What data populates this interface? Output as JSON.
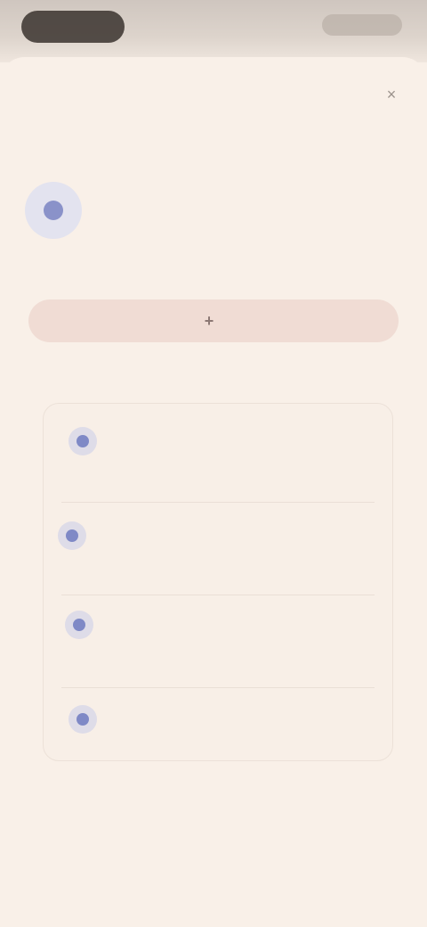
{
  "sheet": {
    "title": "",
    "close_glyph": "×"
  },
  "profile": {
    "name": "",
    "description": ""
  },
  "primary_action": {
    "icon": "+",
    "label": ""
  },
  "items": [
    {
      "title": "",
      "subtitle": ""
    },
    {
      "title": "",
      "subtitle": ""
    },
    {
      "title": "",
      "subtitle": ""
    },
    {
      "title": "",
      "subtitle": ""
    }
  ],
  "colors": {
    "background": "#f9f0e8",
    "accent": "#7f89c6",
    "button_bg": "#f0dcd4",
    "text": "#2b2622"
  }
}
